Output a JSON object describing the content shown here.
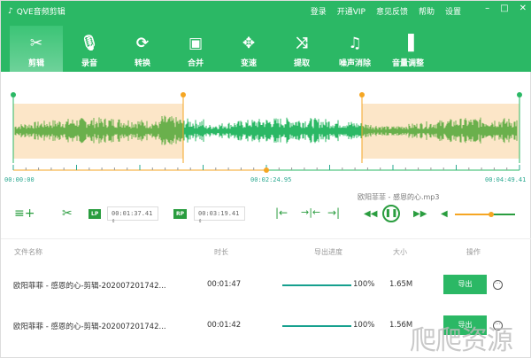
{
  "app": {
    "title": "QVE音频剪辑"
  },
  "menu": [
    "登录",
    "开通VIP",
    "意见反馈",
    "帮助",
    "设置"
  ],
  "window": {
    "minimize": "–",
    "maximize": "□",
    "close": "✕"
  },
  "tools": [
    {
      "label": "剪辑",
      "icon": "✂",
      "active": true
    },
    {
      "label": "录音",
      "icon": "🎙"
    },
    {
      "label": "转换",
      "icon": "⟳"
    },
    {
      "label": "合并",
      "icon": "▣"
    },
    {
      "label": "变速",
      "icon": "✥"
    },
    {
      "label": "提取",
      "icon": "⤨"
    },
    {
      "label": "噪声消除",
      "icon": "♫"
    },
    {
      "label": "音量调整",
      "icon": "▐"
    }
  ],
  "timeline": {
    "start": "00:00:00",
    "current": "00:02:24.95",
    "end": "00:04:49.41",
    "colors": {
      "accent": "#2bb865",
      "selection": "#fce6c8",
      "marker": "#f5a623"
    }
  },
  "controls": {
    "lp_label": "LP",
    "lp_value": "00:01:37.41",
    "rp_label": "RP",
    "rp_value": "00:03:19.41",
    "filename": "欧阳菲菲 - 感恩的心.mp3",
    "volume": 0.6
  },
  "table": {
    "headers": [
      "文件名称",
      "时长",
      "导出进度",
      "大小",
      "操作"
    ],
    "rows": [
      {
        "name": "欧阳菲菲 - 感恩的心-剪辑-202007201742...",
        "duration": "00:01:47",
        "progress": "100%",
        "size": "1.65M",
        "action": "导出"
      },
      {
        "name": "欧阳菲菲 - 感恩的心-剪辑-202007201742...",
        "duration": "00:01:42",
        "progress": "100%",
        "size": "1.56M",
        "action": "导出"
      }
    ]
  },
  "watermark": "爬爬资源"
}
